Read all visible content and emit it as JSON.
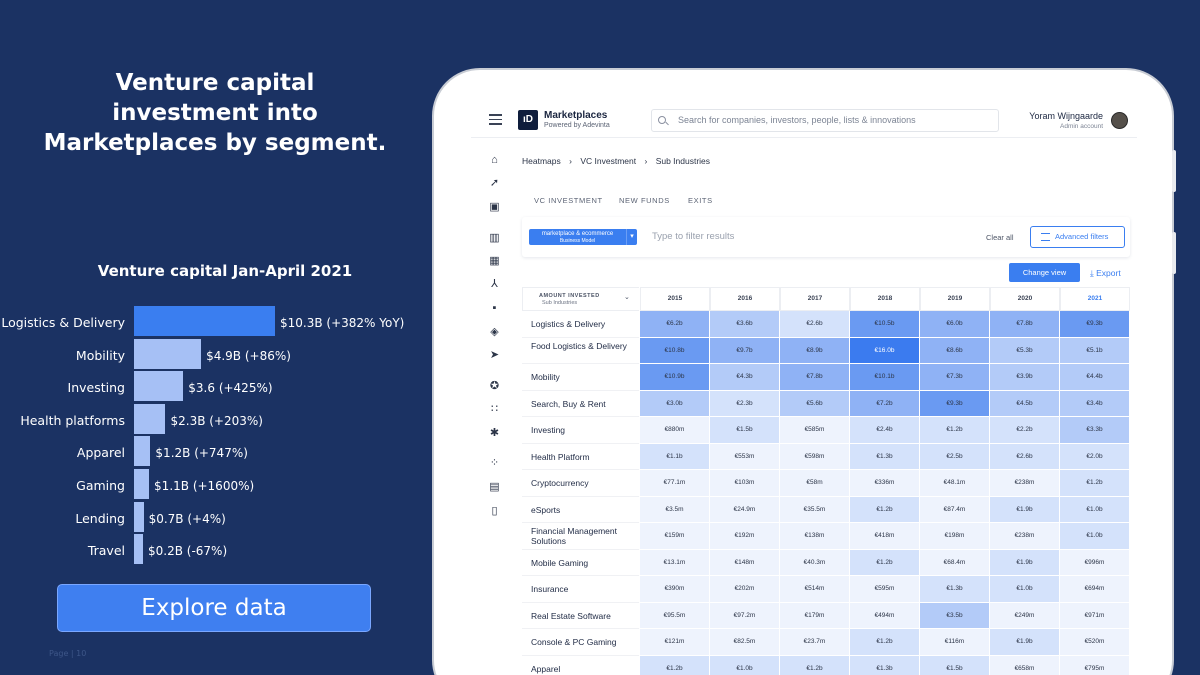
{
  "headline": "Venture capital investment into Marketplaces by segment.",
  "chart_data": {
    "type": "bar",
    "title": "Venture capital Jan-April 2021",
    "categories": [
      "Logistics & Delivery",
      "Mobility",
      "Investing",
      "Health platforms",
      "Apparel",
      "Gaming",
      "Lending",
      "Travel"
    ],
    "values": [
      10.3,
      4.9,
      3.6,
      2.3,
      1.2,
      1.1,
      0.7,
      0.2
    ],
    "labels": [
      "$10.3B (+382% YoY)",
      "$4.9B (+86%)",
      "$3.6 (+425%)",
      "$2.3B (+203%)",
      "$1.2B (+747%)",
      "$1.1B (+1600%)",
      "$0.7B (+4%)",
      "$0.2B (-67%)"
    ],
    "colors": {
      "highlight": "#3a7ef0",
      "default": "#a6c0f5"
    }
  },
  "explore_label": "Explore data",
  "page_label": "Page | 10",
  "app": {
    "brand": "Marketplaces",
    "brand_sub": "Powered by Adevinta",
    "logo_text": "ıD",
    "search_placeholder": "Search for companies, investors, people, lists & innovations",
    "user_name": "Yoram Wijngaarde",
    "user_role": "Admin account",
    "nav_icons": [
      "home-icon",
      "rocket-icon",
      "bookmark-icon",
      "building-icon",
      "buildings-icon",
      "branch-icon",
      "briefcase-icon",
      "map-pin-icon",
      "tag-icon",
      "satellite-icon",
      "grid-icon",
      "network-icon",
      "dots-grid-icon",
      "news-icon",
      "document-icon"
    ],
    "breadcrumb": [
      "Heatmaps",
      "VC Investment",
      "Sub Industries"
    ],
    "tabs": [
      "VC INVESTMENT",
      "NEW FUNDS",
      "EXITS"
    ],
    "select_line1": "marketplace & ecommerce",
    "select_line2": "Business Model",
    "filter_placeholder": "Type to filter results",
    "clear_all": "Clear all",
    "advanced_filters": "Advanced filters",
    "change_view": "Change view",
    "export": "Export",
    "table": {
      "header_l1": "AMOUNT INVESTED",
      "header_l2": "Sub Industries",
      "years": [
        "2015",
        "2016",
        "2017",
        "2018",
        "2019",
        "2020",
        "2021"
      ],
      "rows": [
        {
          "label": "Logistics & Delivery",
          "values": [
            "€6.2b",
            "€3.6b",
            "€2.6b",
            "€10.5b",
            "€6.0b",
            "€7.8b",
            "€9.3b"
          ],
          "levels": [
            3,
            2,
            1,
            4,
            3,
            3,
            4
          ]
        },
        {
          "label": "Food Logistics & Delivery",
          "values": [
            "€10.8b",
            "€9.7b",
            "€8.9b",
            "€16.0b",
            "€8.6b",
            "€5.3b",
            "€5.1b"
          ],
          "levels": [
            4,
            3,
            3,
            5,
            3,
            2,
            2
          ]
        },
        {
          "label": "Mobility",
          "values": [
            "€10.9b",
            "€4.3b",
            "€7.8b",
            "€10.1b",
            "€7.3b",
            "€3.9b",
            "€4.4b"
          ],
          "levels": [
            4,
            2,
            3,
            4,
            3,
            2,
            2
          ]
        },
        {
          "label": "Search, Buy & Rent",
          "values": [
            "€3.0b",
            "€2.3b",
            "€5.6b",
            "€7.2b",
            "€9.3b",
            "€4.5b",
            "€3.4b"
          ],
          "levels": [
            2,
            1,
            2,
            3,
            4,
            2,
            2
          ]
        },
        {
          "label": "Investing",
          "values": [
            "€880m",
            "€1.5b",
            "€585m",
            "€2.4b",
            "€1.2b",
            "€2.2b",
            "€3.3b"
          ],
          "levels": [
            0,
            1,
            0,
            1,
            1,
            1,
            2
          ]
        },
        {
          "label": "Health Platform",
          "values": [
            "€1.1b",
            "€553m",
            "€598m",
            "€1.3b",
            "€2.5b",
            "€2.6b",
            "€2.0b"
          ],
          "levels": [
            1,
            0,
            0,
            1,
            1,
            1,
            1
          ]
        },
        {
          "label": "Cryptocurrency",
          "values": [
            "€77.1m",
            "€103m",
            "€58m",
            "€336m",
            "€48.1m",
            "€238m",
            "€1.2b"
          ],
          "levels": [
            0,
            0,
            0,
            0,
            0,
            0,
            1
          ]
        },
        {
          "label": "eSports",
          "values": [
            "€3.5m",
            "€24.9m",
            "€35.5m",
            "€1.2b",
            "€87.4m",
            "€1.9b",
            "€1.0b"
          ],
          "levels": [
            0,
            0,
            0,
            1,
            0,
            1,
            1
          ]
        },
        {
          "label": "Financial Management Solutions",
          "values": [
            "€159m",
            "€192m",
            "€138m",
            "€418m",
            "€198m",
            "€238m",
            "€1.0b"
          ],
          "levels": [
            0,
            0,
            0,
            0,
            0,
            0,
            1
          ]
        },
        {
          "label": "Mobile Gaming",
          "values": [
            "€13.1m",
            "€148m",
            "€40.3m",
            "€1.2b",
            "€68.4m",
            "€1.9b",
            "€996m"
          ],
          "levels": [
            0,
            0,
            0,
            1,
            0,
            1,
            0
          ]
        },
        {
          "label": "Insurance",
          "values": [
            "€390m",
            "€202m",
            "€514m",
            "€595m",
            "€1.3b",
            "€1.0b",
            "€694m"
          ],
          "levels": [
            0,
            0,
            0,
            0,
            1,
            1,
            0
          ]
        },
        {
          "label": "Real Estate Software",
          "values": [
            "€95.5m",
            "€97.2m",
            "€179m",
            "€494m",
            "€3.5b",
            "€249m",
            "€971m"
          ],
          "levels": [
            0,
            0,
            0,
            0,
            2,
            0,
            0
          ]
        },
        {
          "label": "Console & PC Gaming",
          "values": [
            "€121m",
            "€82.5m",
            "€23.7m",
            "€1.2b",
            "€116m",
            "€1.9b",
            "€520m"
          ],
          "levels": [
            0,
            0,
            0,
            1,
            0,
            1,
            0
          ]
        },
        {
          "label": "Apparel",
          "values": [
            "€1.2b",
            "€1.0b",
            "€1.2b",
            "€1.3b",
            "€1.5b",
            "€658m",
            "€795m"
          ],
          "levels": [
            1,
            1,
            1,
            1,
            1,
            0,
            0
          ]
        }
      ]
    },
    "heat_colors": [
      "#eef3fd",
      "#d4e2fb",
      "#b3cbf8",
      "#8fb2f5",
      "#6a9af2",
      "#3b7bef"
    ]
  }
}
